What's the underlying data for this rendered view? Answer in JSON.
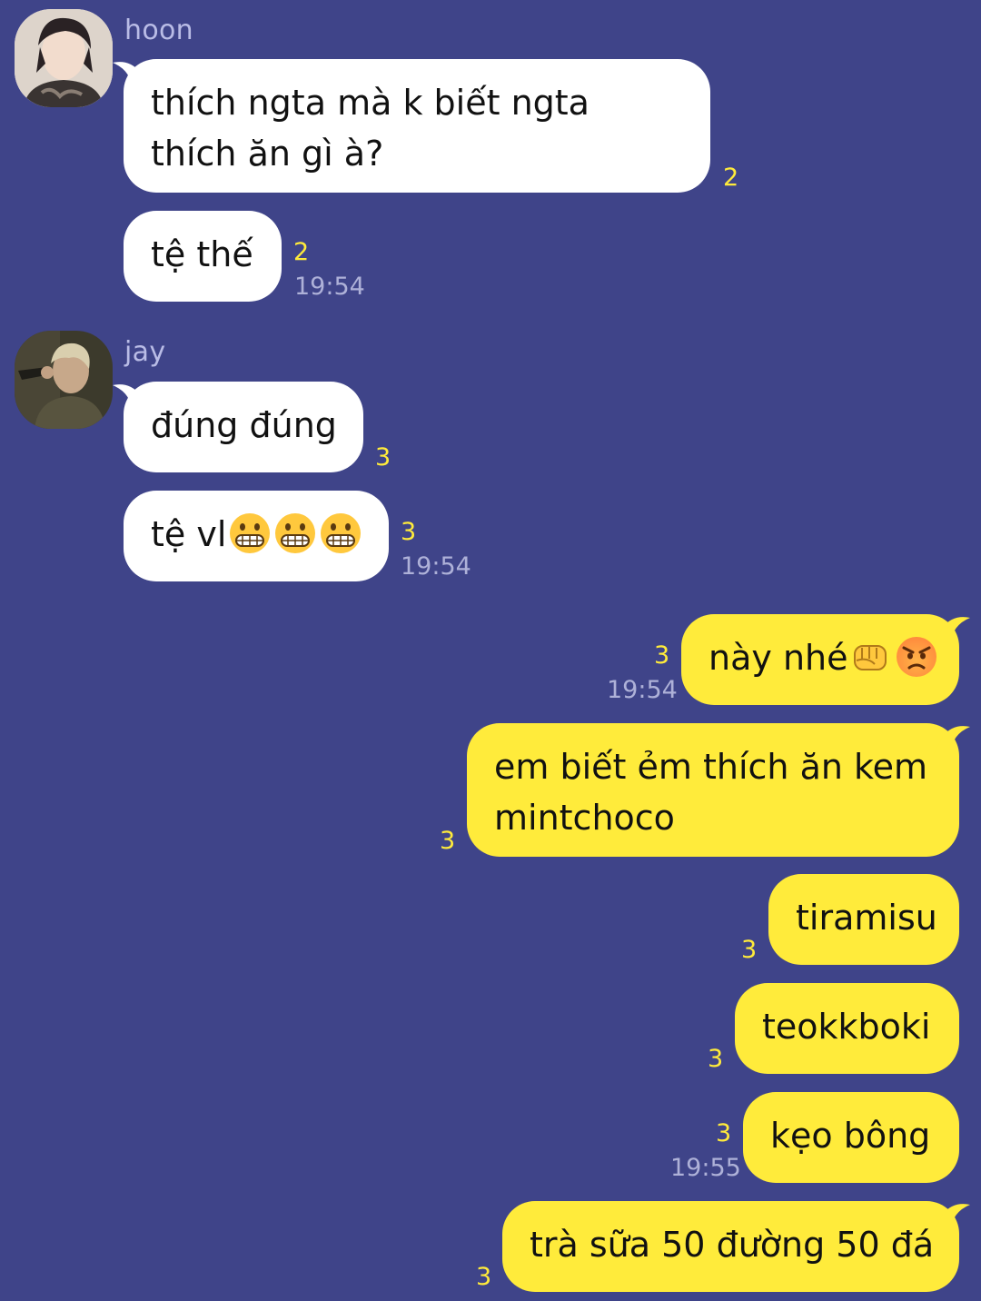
{
  "theme": {
    "background": "#3f4489",
    "incoming_bubble": "#ffffff",
    "outgoing_bubble": "#ffeb3b",
    "unread_count": "#ffeb3b",
    "timestamp": "#aeb1d8"
  },
  "messages": {
    "hoon": {
      "name": "hoon",
      "avatar_icon": "avatar-hoon",
      "m1": {
        "text": "thích ngta mà k biết ngta thích ăn gì à?",
        "unread": "2"
      },
      "m2": {
        "text": "tệ thế",
        "unread": "2",
        "time": "19:54"
      }
    },
    "jay": {
      "name": "jay",
      "avatar_icon": "avatar-jay",
      "m1": {
        "text": "đúng đúng",
        "unread": "3"
      },
      "m2": {
        "text": "tệ vl",
        "emojis": [
          "grimacing-face",
          "grimacing-face",
          "grimacing-face"
        ],
        "unread": "3",
        "time": "19:54"
      }
    },
    "me": {
      "m1": {
        "text": "này nhé",
        "emojis": [
          "oncoming-fist",
          "pouting-face"
        ],
        "unread": "3",
        "time": "19:54"
      },
      "m2": {
        "text": "em biết ẻm thích ăn kem mintchoco",
        "unread": "3"
      },
      "m3": {
        "text": "tiramisu",
        "unread": "3"
      },
      "m4": {
        "text": "teokkboki",
        "unread": "3"
      },
      "m5": {
        "text": "kẹo bông",
        "unread": "3",
        "time": "19:55"
      },
      "m6": {
        "text": "trà sữa 50 đường 50 đá",
        "unread": "3"
      }
    }
  }
}
